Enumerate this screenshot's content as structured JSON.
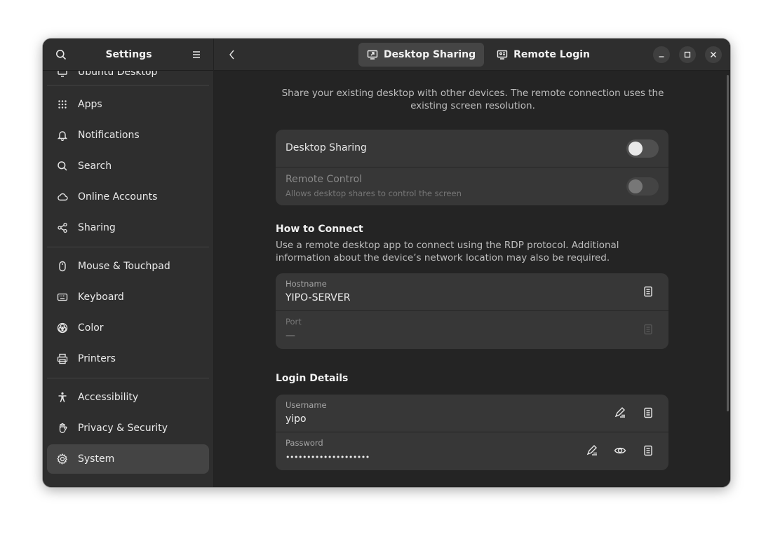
{
  "sidebar": {
    "title": "Settings",
    "partial_item": "Ubuntu Desktop",
    "groups": [
      [
        {
          "label": "Apps",
          "icon": "apps-grid-icon"
        },
        {
          "label": "Notifications",
          "icon": "bell-icon"
        },
        {
          "label": "Search",
          "icon": "search-icon"
        },
        {
          "label": "Online Accounts",
          "icon": "cloud-icon"
        },
        {
          "label": "Sharing",
          "icon": "share-icon"
        }
      ],
      [
        {
          "label": "Mouse & Touchpad",
          "icon": "mouse-icon"
        },
        {
          "label": "Keyboard",
          "icon": "keyboard-icon"
        },
        {
          "label": "Color",
          "icon": "color-icon"
        },
        {
          "label": "Printers",
          "icon": "printer-icon"
        }
      ],
      [
        {
          "label": "Accessibility",
          "icon": "accessibility-icon"
        },
        {
          "label": "Privacy & Security",
          "icon": "hand-icon"
        },
        {
          "label": "System",
          "icon": "gear-icon",
          "selected": true
        }
      ]
    ]
  },
  "header": {
    "tabs": [
      {
        "label": "Desktop Sharing",
        "icon": "desktop-sharing-icon",
        "active": true
      },
      {
        "label": "Remote Login",
        "icon": "remote-login-icon",
        "active": false
      }
    ]
  },
  "main": {
    "description": "Share your existing desktop with other devices. The remote connection uses the existing screen resolution.",
    "sharing_card": {
      "desktop_sharing": {
        "label": "Desktop Sharing",
        "enabled": false
      },
      "remote_control": {
        "label": "Remote Control",
        "sublabel": "Allows desktop shares to control the screen",
        "enabled": false
      }
    },
    "how_to_connect": {
      "title": "How to Connect",
      "description": "Use a remote desktop app to connect using the RDP protocol. Additional information about the device’s network location may also be required.",
      "hostname": {
        "caption": "Hostname",
        "value": "YIPO-SERVER"
      },
      "port": {
        "caption": "Port",
        "value": "—"
      }
    },
    "login_details": {
      "title": "Login Details",
      "username": {
        "caption": "Username",
        "value": "yipo"
      },
      "password": {
        "caption": "Password",
        "value": "••••••••••••••••••••"
      }
    }
  }
}
